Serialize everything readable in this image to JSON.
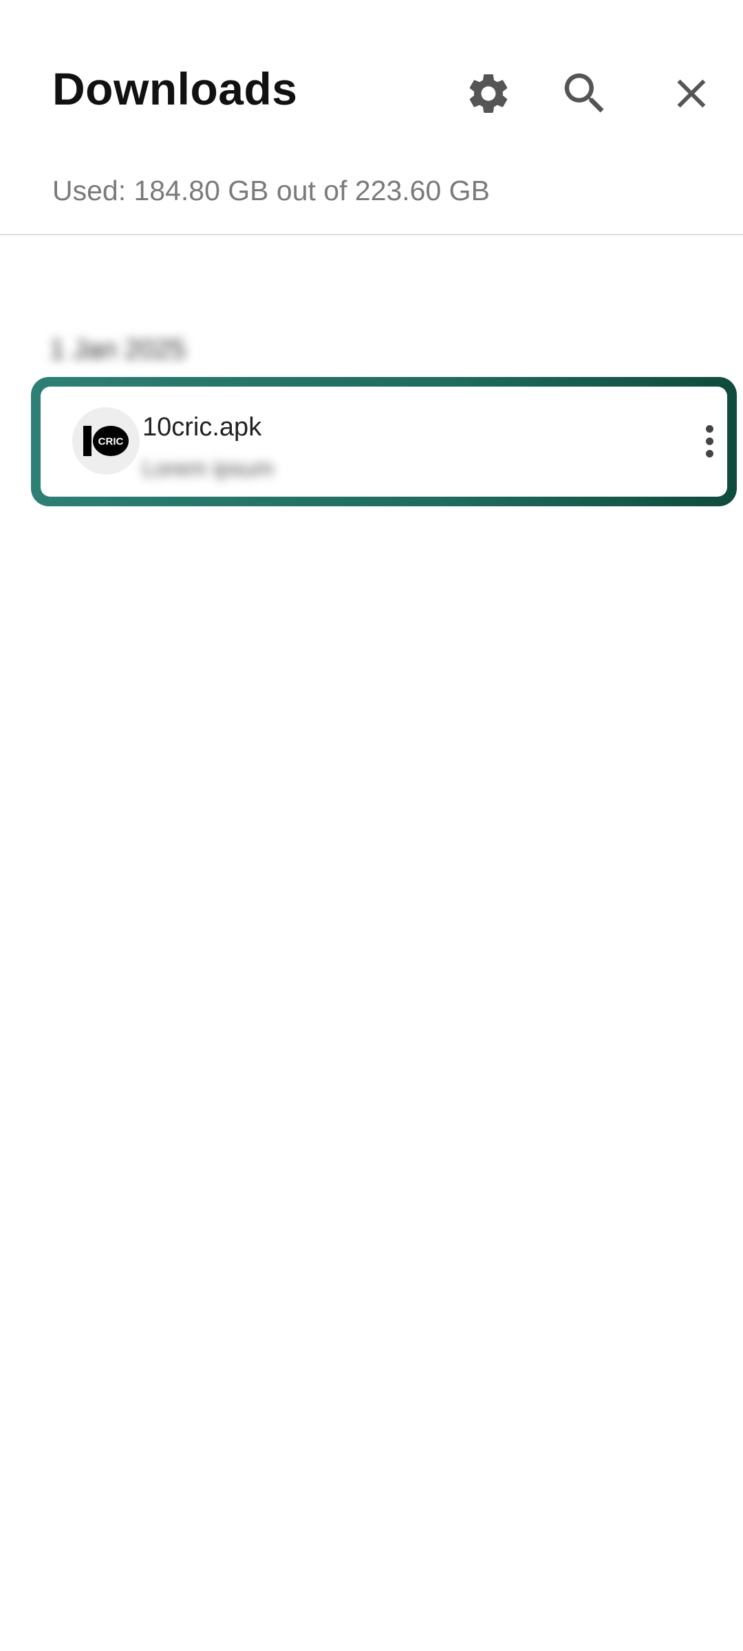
{
  "header": {
    "title": "Downloads",
    "icons": [
      "gear-icon",
      "search-icon",
      "close-icon"
    ]
  },
  "storage": {
    "text": "Used: 184.80 GB out of 223.60 GB"
  },
  "downloads": {
    "date_group": "1 Jan 2025",
    "items": [
      {
        "name": "10cric.apk",
        "subtitle": "Lorem ipsum",
        "icon": "10cric-logo-icon",
        "logo_text": "CRIC",
        "menu_icon": "more-vert-icon"
      }
    ]
  },
  "colors": {
    "highlight_start": "#2e7f75",
    "highlight_end": "#0f4b3c",
    "icon_gray": "#555555",
    "subtext_gray": "#7a7a7a"
  }
}
